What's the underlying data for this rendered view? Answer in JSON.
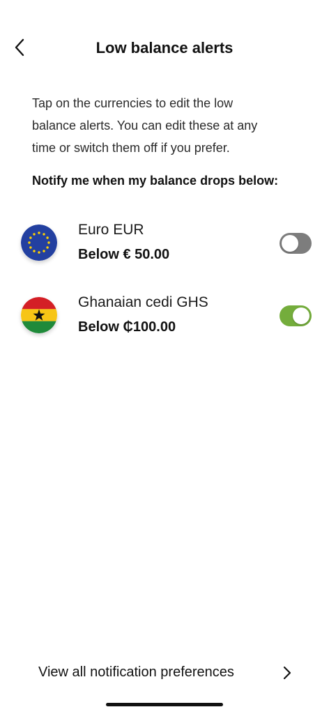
{
  "header": {
    "title": "Low balance alerts",
    "back_icon": "chevron-left-icon"
  },
  "intro": {
    "line1": "Tap on the currencies to edit the low",
    "line2": "balance alerts. You can edit these at any",
    "line3": "time or switch them off if you prefer."
  },
  "subheading": "Notify me when my balance drops below:",
  "currencies": [
    {
      "name": "Euro EUR",
      "threshold": "Below € 50.00",
      "flag_icon": "eu-flag-icon",
      "alert_enabled": false
    },
    {
      "name": "Ghanaian cedi GHS",
      "threshold": "Below ₵100.00",
      "flag_icon": "ghana-flag-icon",
      "alert_enabled": true
    }
  ],
  "footer": {
    "link_label": "View all notification preferences",
    "chevron_icon": "chevron-right-icon"
  },
  "colors": {
    "toggle_on": "#74ad3c",
    "toggle_off": "#7d7d7d",
    "eu_blue": "#2340a0",
    "eu_star": "#ffd200",
    "ghana_red": "#d41f26",
    "ghana_gold": "#f7c515",
    "ghana_green": "#1f8a3a"
  }
}
